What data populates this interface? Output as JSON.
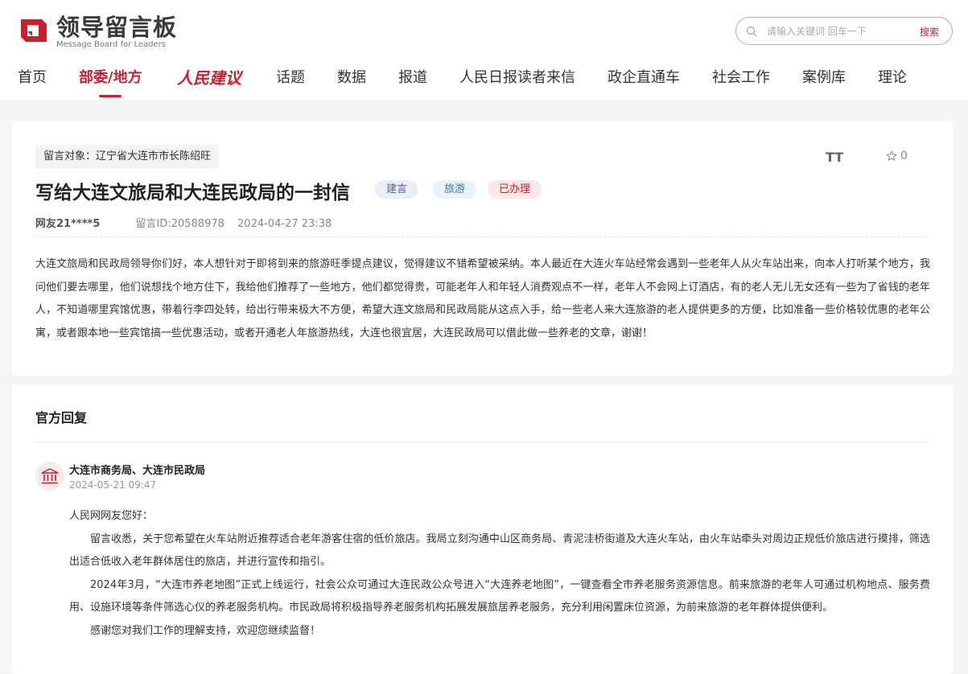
{
  "brand": {
    "title": "领导留言板",
    "subtitle": "Message Board for Leaders",
    "accent": "#c8202e"
  },
  "search": {
    "placeholder": "请输入关键词 回车一下",
    "button": "搜索",
    "icon": "search-icon"
  },
  "nav": {
    "items": [
      {
        "label": "首页"
      },
      {
        "label": "部委/地方",
        "active": true
      },
      {
        "label": "人民建议"
      },
      {
        "label": "话题"
      },
      {
        "label": "数据"
      },
      {
        "label": "报道"
      },
      {
        "label": "人民日报读者来信"
      },
      {
        "label": "政企直通车"
      },
      {
        "label": "社会工作"
      },
      {
        "label": "案例库"
      },
      {
        "label": "理论"
      }
    ]
  },
  "letter": {
    "target": "留言对象：辽宁省大连市市长陈绍旺",
    "font_tool": "TT",
    "star_count": "0",
    "title": "写给大连文旅局和大连民政局的一封信",
    "tags": [
      "建言",
      "旅游",
      "已办理"
    ],
    "user": "网友21****5",
    "message_id": "留言ID:20588978",
    "datetime": "2024-04-27 23:38",
    "body": "大连文旅局和民政局领导你们好，本人想针对于即将到来的旅游旺季提点建议，觉得建议不错希望被采纳。本人最近在大连火车站经常会遇到一些老年人从火车站出来，向本人打听某个地方，我问他们要去哪里，他们说想找个地方住下，我给他们推荐了一些地方，他们都觉得贵，可能老年人和年轻人消费观点不一样，老年人不会网上订酒店，有的老人无儿无女还有一些为了省钱的老年人，不知道哪里宾馆优惠，带着行李四处转，给出行带来极大不方便，希望大连文旅局和民政局能从这点入手，给一些老人来大连旅游的老人提供更多的方便，比如准备一些价格较优惠的老年公寓，或者跟本地一些宾馆搞一些优惠活动，或者开通老人年旅游热线，大连也很宜居，大连民政局可以借此做一些养老的文章，谢谢！"
  },
  "reply": {
    "heading": "官方回复",
    "department": "大连市商务局、大连市民政局",
    "datetime": "2024-05-21 09:47",
    "greeting": "人民网网友您好：",
    "paragraphs": [
      "留言收悉，关于您希望在火车站附近推荐适合老年游客住宿的低价旅店。我局立刻沟通中山区商务局、青泥洼桥街道及大连火车站，由火车站牵头对周边正规低价旅店进行摸排，筛选出适合低收入老年群体居住的旅店，并进行宣传和指引。",
      "2024年3月，“大连市养老地图”正式上线运行，社会公众可通过大连民政公众号进入“大连养老地图”，一键查看全市养老服务资源信息。前来旅游的老年人可通过机构地点、服务费用、设施环境等条件筛选心仪的养老服务机构。市民政局将积极指导养老服务机构拓展发展旅居养老服务，充分利用闲置床位资源，为前来旅游的老年群体提供便利。",
      "感谢您对我们工作的理解支持，欢迎您继续监督！"
    ]
  }
}
